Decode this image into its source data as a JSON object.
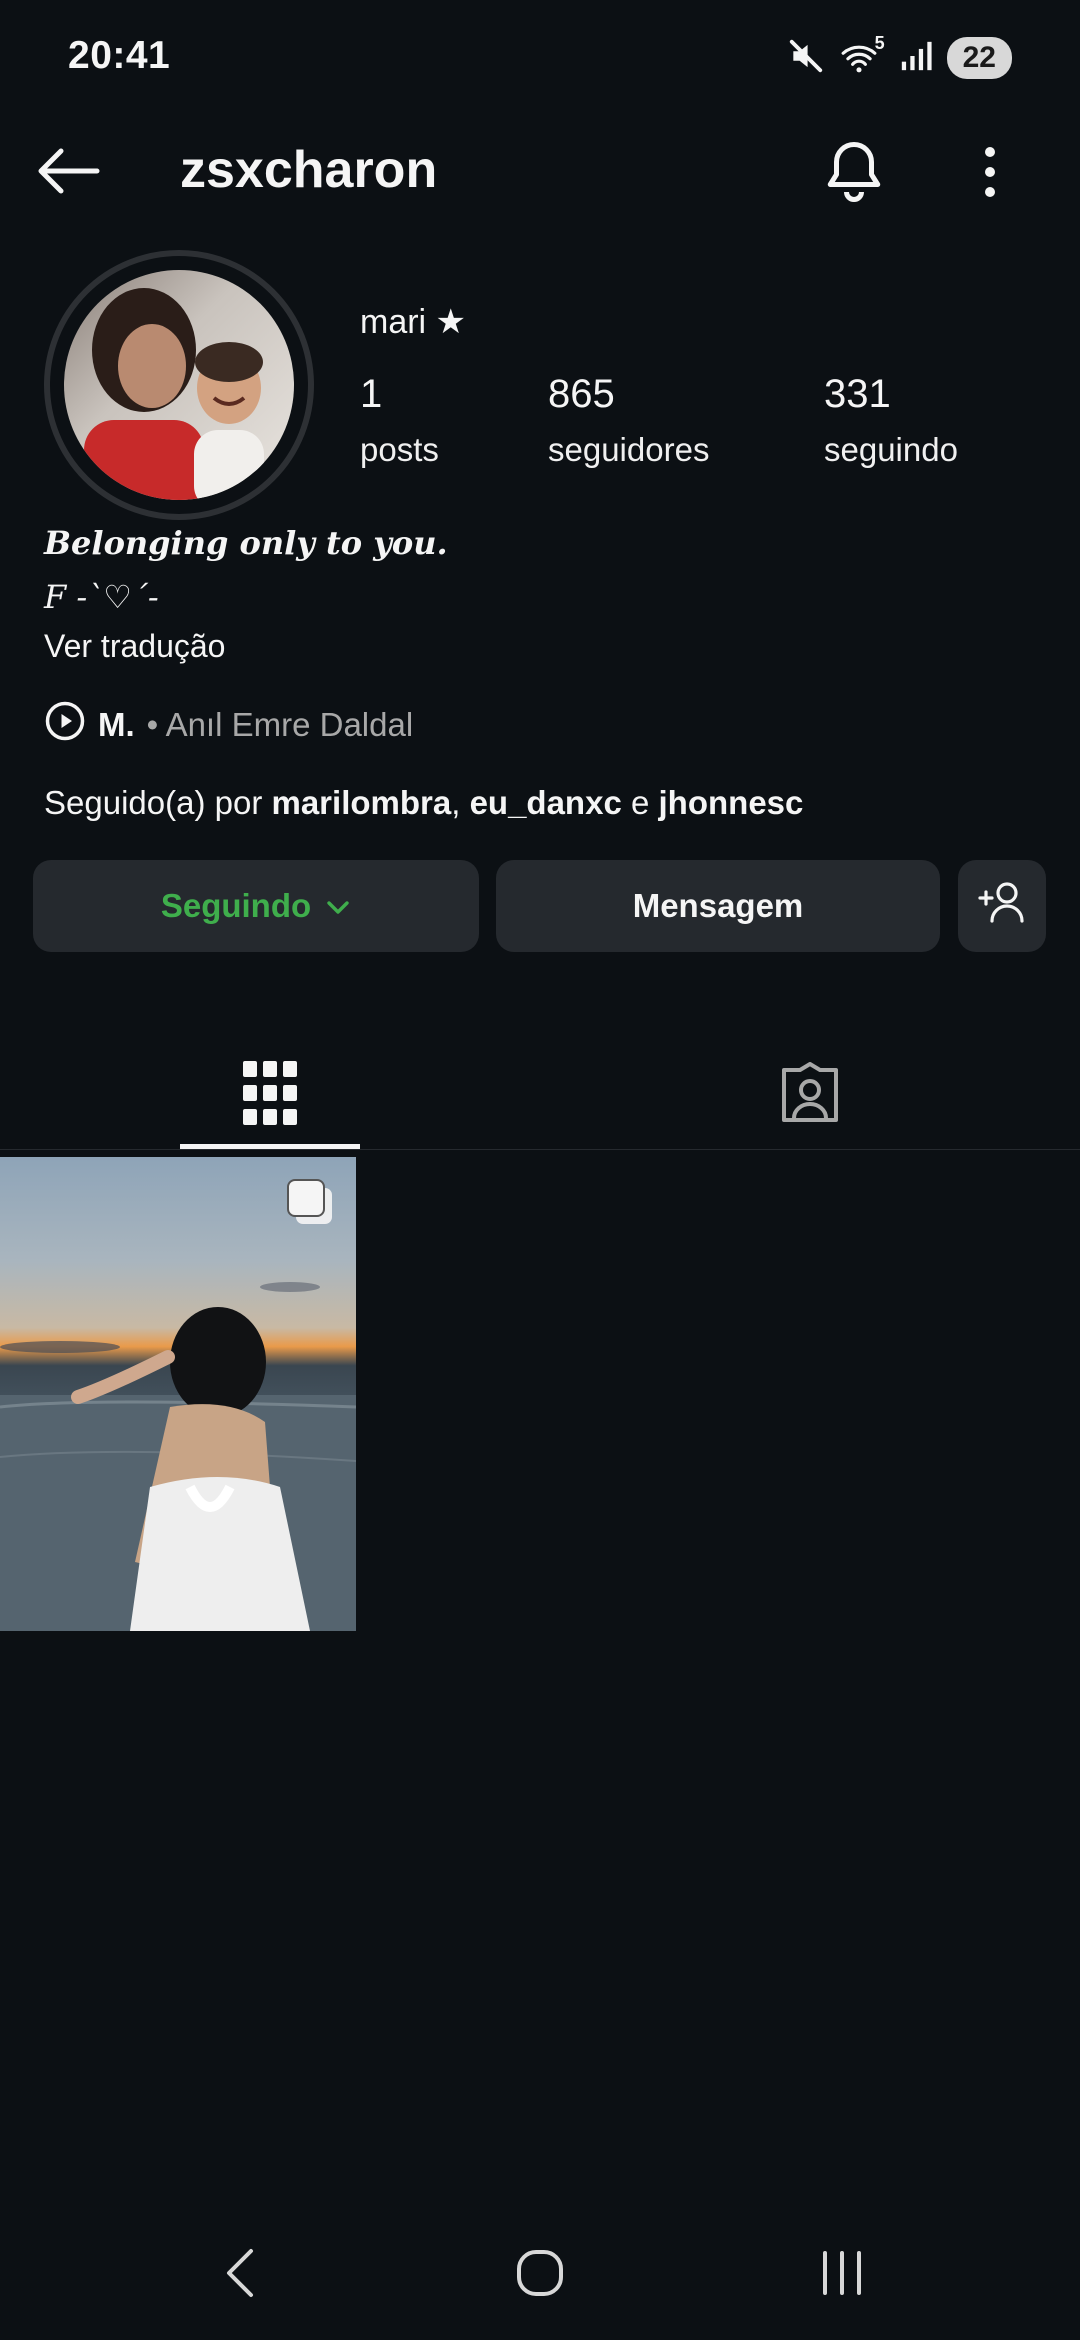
{
  "status_bar": {
    "time": "20:41",
    "signal_label": "5",
    "battery": "22"
  },
  "header": {
    "username": "zsxcharon"
  },
  "profile": {
    "display_name": "mari ★",
    "stats": [
      {
        "value": "1",
        "label": "posts"
      },
      {
        "value": "865",
        "label": "seguidores"
      },
      {
        "value": "331",
        "label": "seguindo"
      }
    ],
    "bio_line1": "Belonging only to you.",
    "bio_line2": "F -`♡´-",
    "translate_link": "Ver tradução",
    "music": {
      "title": "M.",
      "artist": "• Anıl Emre Daldal"
    },
    "followed_by": {
      "prefix": "Seguido(a) por ",
      "user1": "marilombra",
      "sep1": ", ",
      "user2": "eu_danxc",
      "sep2": " e ",
      "user3": "jhonnesc"
    }
  },
  "actions": {
    "following_label": "Seguindo",
    "message_label": "Mensagem"
  },
  "tabs": {
    "active": "grid"
  },
  "colors": {
    "background": "#0c1014",
    "button_bg": "#25292e",
    "following_green": "#3fae4c"
  }
}
